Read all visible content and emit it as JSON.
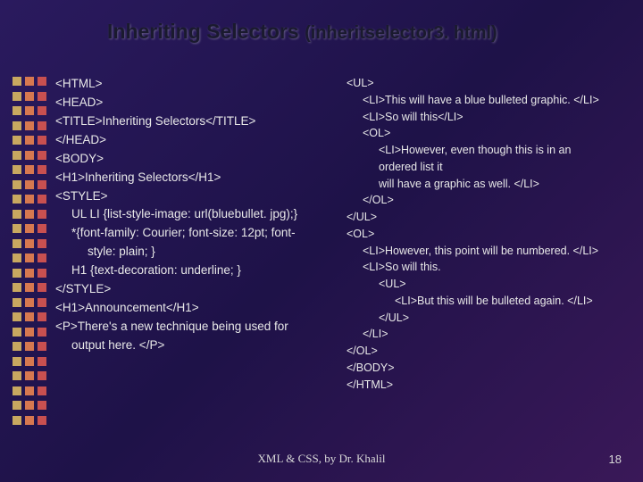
{
  "title_main": "Inheriting Selectors ",
  "title_sub": "(inheritselector3. html)",
  "left": {
    "l0": "<HTML>",
    "l1": "<HEAD>",
    "l2": "<TITLE>Inheriting Selectors</TITLE>",
    "l3": "</HEAD>",
    "l4": "<BODY>",
    "l5": "<H1>Inheriting Selectors</H1>",
    "l6": "<STYLE>",
    "l7": "UL LI {list-style-image: url(bluebullet. jpg);}",
    "l8a": "*{font-family: Courier; font-size: 12pt; font-",
    "l8b": "style: plain; }",
    "l9": "H1 {text-decoration: underline; }",
    "l10": "</STYLE>",
    "l11": "<H1>Announcement</H1>",
    "l12a": "<P>There's a new technique being used for",
    "l12b": "output here. </P>"
  },
  "right": {
    "r0": "<UL>",
    "r1": "<LI>This will have a blue bulleted graphic. </LI>",
    "r2": "<LI>So will this</LI>",
    "r3": "<OL>",
    "r4a": "<LI>However, even though this is in an",
    "r4b": "ordered list it",
    "r4c": "will have a graphic as well. </LI>",
    "r5": "</OL>",
    "r6": "</UL>",
    "r7": "<OL>",
    "r8": "<LI>However, this point will be numbered. </LI>",
    "r9": "<LI>So will this.",
    "r10": "<UL>",
    "r11": "<LI>But this will be bulleted again. </LI>",
    "r12": "</UL>",
    "r13": "</LI>",
    "r14": "</OL>",
    "r15": "</BODY>",
    "r16": "</HTML>"
  },
  "footer": "XML & CSS, by Dr. Khalil",
  "page": "18"
}
